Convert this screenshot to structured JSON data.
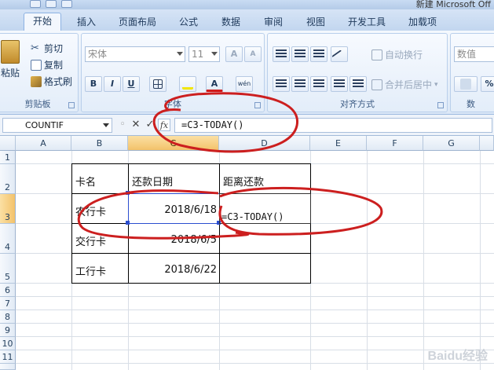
{
  "window": {
    "title": "新建 Microsoft Off"
  },
  "tabs": [
    "开始",
    "插入",
    "页面布局",
    "公式",
    "数据",
    "审阅",
    "视图",
    "开发工具",
    "加载项"
  ],
  "ribbon": {
    "clipboard": {
      "paste": "粘贴",
      "cut": "剪切",
      "copy": "复制",
      "format_painter": "格式刷",
      "label": "剪贴板"
    },
    "font": {
      "name": "宋体",
      "size": "11",
      "label": "字体",
      "bold": "B",
      "italic": "I",
      "underline": "U",
      "grow": "A",
      "shrink": "A",
      "font_color": "A",
      "phonetic": "wén"
    },
    "alignment": {
      "wrap": "自动换行",
      "merge": "合并后居中",
      "label": "对齐方式"
    },
    "number": {
      "format": "数值",
      "percent": "%",
      "label": "数"
    }
  },
  "formula_bar": {
    "name_box": "COUNTIF",
    "fx": "fx",
    "cancel": "✕",
    "enter": "✓",
    "formula": "=C3-TODAY()"
  },
  "columns": [
    "A",
    "B",
    "C",
    "D",
    "E",
    "F",
    "G"
  ],
  "rows": [
    "1",
    "2",
    "3",
    "4",
    "5",
    "6",
    "7",
    "8",
    "9",
    "10",
    "11"
  ],
  "table": {
    "headers": [
      "卡名",
      "还款日期",
      "距离还款"
    ],
    "rows": [
      {
        "name": "农行卡",
        "date": "2018/6/18",
        "days": "=C3-TODAY()"
      },
      {
        "name": "交行卡",
        "date": "2018/6/5",
        "days": ""
      },
      {
        "name": "工行卡",
        "date": "2018/6/22",
        "days": ""
      }
    ]
  },
  "watermark": "Baidu经验",
  "colors": {
    "annotation": "#cc1f1f",
    "selected_header": "#f3c26a",
    "ribbon": "#dce8f7"
  }
}
